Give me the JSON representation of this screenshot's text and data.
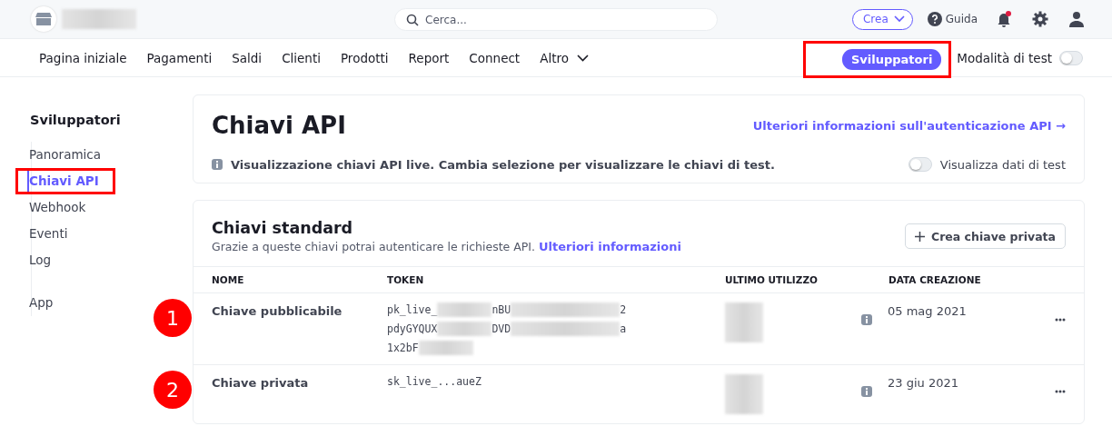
{
  "topbar": {
    "search": {
      "placeholder": "Cerca..."
    },
    "create_button": "Crea",
    "help": "Guida",
    "notification_unread": true
  },
  "nav": {
    "items": [
      {
        "label": "Pagina iniziale"
      },
      {
        "label": "Pagamenti"
      },
      {
        "label": "Saldi"
      },
      {
        "label": "Clienti"
      },
      {
        "label": "Prodotti"
      },
      {
        "label": "Report"
      },
      {
        "label": "Connect"
      },
      {
        "label": "Altro",
        "dropdown": true
      }
    ],
    "developers_button": {
      "label": "Sviluppatori",
      "highlighted": true
    },
    "test_mode": {
      "label": "Modalità di test",
      "on": false
    }
  },
  "sidebar": {
    "title": "Sviluppatori",
    "items": [
      {
        "label": "Panoramica",
        "selected": false,
        "highlighted": false
      },
      {
        "label": "Chiavi API",
        "selected": true,
        "highlighted": true
      },
      {
        "label": "Webhook",
        "selected": false,
        "highlighted": false
      },
      {
        "label": "Eventi",
        "selected": false,
        "highlighted": false
      },
      {
        "label": "Log",
        "selected": false,
        "highlighted": false
      },
      {
        "label": "App",
        "selected": false,
        "highlighted": false,
        "separated": true
      }
    ]
  },
  "header_card": {
    "title": "Chiavi API",
    "link": "Ulteriori informazioni sull'autenticazione API →",
    "notice": "Visualizzazione chiavi API live. Cambia selezione per visualizzare le chiavi di test.",
    "toggle": {
      "label": "Visualizza dati di test",
      "on": false
    }
  },
  "keys_card": {
    "title": "Chiavi standard",
    "description": "Grazie a queste chiavi potrai autenticare le richieste API.",
    "description_link": "Ulteriori informazioni",
    "button": "Crea chiave privata",
    "columns": [
      "NOME",
      "TOKEN",
      "ULTIMO UTILIZZO",
      "DATA CREAZIONE"
    ],
    "rows": [
      {
        "marker": "1",
        "name": "Chiave pubblicabile",
        "token_lines": [
          {
            "parts": [
              "pk_live_",
              "nBU",
              "2"
            ]
          },
          {
            "parts": [
              "pdyGYQUX",
              "DVD",
              "a"
            ]
          },
          {
            "parts": [
              "1x2bF"
            ],
            "redacted_end": true
          }
        ],
        "created": "05 mag 2021"
      },
      {
        "marker": "2",
        "name": "Chiave privata",
        "token_lines": [
          {
            "parts": [
              "sk_live_...aueZ"
            ]
          }
        ],
        "created": "23 giu 2021"
      }
    ]
  }
}
